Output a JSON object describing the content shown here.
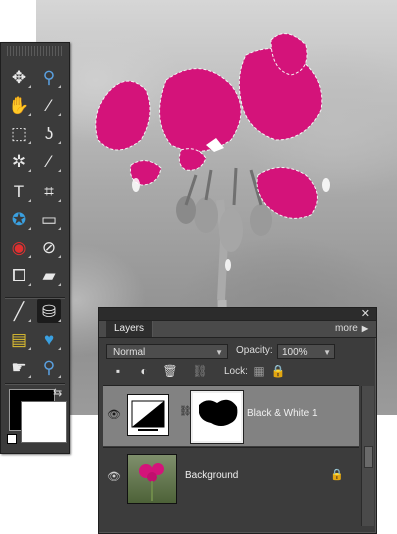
{
  "photo": {
    "description_none": ""
  },
  "toolbox": {
    "tools": [
      {
        "name": "move-tool-icon",
        "glyph": "✥"
      },
      {
        "name": "zoom-tool-icon",
        "glyph": "⚲"
      },
      {
        "name": "hand-tool-icon",
        "glyph": "✋"
      },
      {
        "name": "eyedropper-tool-icon",
        "glyph": "⁄"
      },
      {
        "name": "marquee-tool-icon",
        "glyph": "⬚"
      },
      {
        "name": "lasso-tool-icon",
        "glyph": "ʖ"
      },
      {
        "name": "magic-wand-tool-icon",
        "glyph": "✲"
      },
      {
        "name": "selection-brush-tool-icon",
        "glyph": "⁄"
      },
      {
        "name": "type-tool-icon",
        "glyph": "T"
      },
      {
        "name": "crop-tool-icon",
        "glyph": "⌗"
      },
      {
        "name": "cookie-cutter-tool-icon",
        "glyph": "✪"
      },
      {
        "name": "straighten-tool-icon",
        "glyph": "▭"
      },
      {
        "name": "red-eye-tool-icon",
        "glyph": "◉"
      },
      {
        "name": "spot-healing-tool-icon",
        "glyph": "⊘"
      },
      {
        "name": "clone-stamp-tool-icon",
        "glyph": "⧠"
      },
      {
        "name": "eraser-tool-icon",
        "glyph": "▰"
      },
      {
        "name": "brush-tool-icon",
        "glyph": "╱"
      },
      {
        "name": "paint-bucket-tool-icon",
        "glyph": "⛁"
      },
      {
        "name": "gradient-tool-icon",
        "glyph": "▤"
      },
      {
        "name": "shape-tool-icon",
        "glyph": "♥"
      },
      {
        "name": "smudge-tool-icon",
        "glyph": "☛"
      },
      {
        "name": "sponge-tool-icon",
        "glyph": "⚲"
      }
    ]
  },
  "layers_panel": {
    "tab_label": "Layers",
    "more_label": "more",
    "blend_mode": "Normal",
    "opacity_label": "Opacity:",
    "opacity_value": "100%",
    "lock_label": "Lock:",
    "layers": [
      {
        "name": "Black & White 1",
        "active": true
      },
      {
        "name": "Background",
        "active": false
      }
    ]
  }
}
